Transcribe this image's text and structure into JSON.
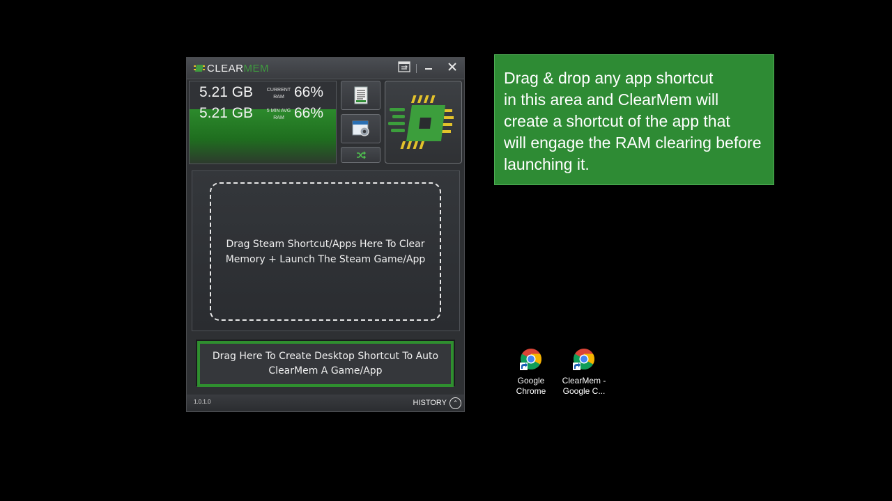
{
  "window": {
    "logo_clear": "CLEAR",
    "logo_mem": "MEM",
    "stats": {
      "current_value": "5.21 GB",
      "current_label": "CURRENT RAM",
      "current_percent": "66%",
      "avg_value": "5.21 GB",
      "avg_label": "5 MIN AVG RAM",
      "avg_percent": "66%",
      "fill_percent": 66
    },
    "drop_zone_text": "Drag Steam Shortcut/Apps Here To Clear Memory + Launch The Steam Game/App",
    "shortcut_zone_text": "Drag Here To Create Desktop Shortcut To Auto ClearMem A Game/App",
    "version": "1.0.1.0",
    "history_label": "HISTORY"
  },
  "callout": {
    "lines": [
      "Drag & drop any app shortcut",
      "in this area and ClearMem will",
      "create a shortcut of the app that",
      "will engage the RAM clearing before",
      "launching it."
    ]
  },
  "desktop": {
    "icons": [
      {
        "label_1": "Google",
        "label_2": "Chrome",
        "icon": "chrome-icon"
      },
      {
        "label_1": "ClearMem -",
        "label_2": "Google C...",
        "icon": "chrome-icon"
      }
    ]
  },
  "colors": {
    "accent_green": "#2e8b34",
    "chip_yellow": "#e3c22b",
    "window_bg": "#2e3033"
  }
}
